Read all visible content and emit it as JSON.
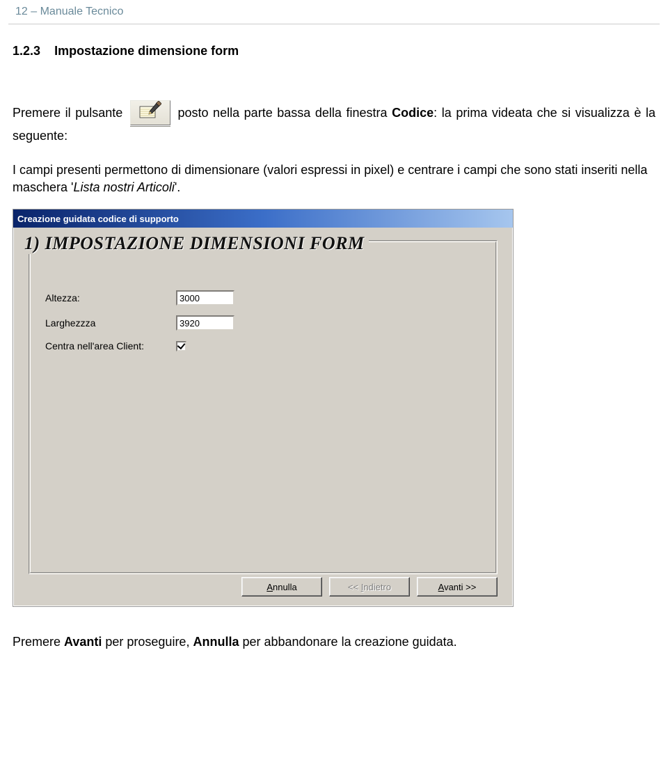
{
  "header": {
    "text": "12 – Manuale Tecnico"
  },
  "section": {
    "number": "1.2.3",
    "title": "Impostazione dimensione form"
  },
  "para1": {
    "before": "Premere il pulsante",
    "after_1": "posto nella parte bassa della finestra ",
    "codice_label": "Codice",
    "after_2": ": la prima videata che si visualizza è la seguente:"
  },
  "para2": {
    "line1": "I campi presenti permettono di dimensionare (valori espressi in pixel) e centrare i campi che sono stati inseriti nella maschera '",
    "italic": "Lista nostri Articoli",
    "after": "'."
  },
  "dialog": {
    "title": "Creazione guidata codice di supporto",
    "heading": "1) IMPOSTAZIONE DIMENSIONI FORM",
    "fields": {
      "altezza": {
        "label": "Altezza:",
        "value": "3000"
      },
      "larghezza": {
        "label": "Larghezzza",
        "value": "3920"
      },
      "centra": {
        "label": "Centra nell'area Client:",
        "checked": true
      }
    },
    "buttons": {
      "annulla": {
        "u": "A",
        "rest": "nnulla"
      },
      "indietro": {
        "prefix": "<<  ",
        "u": "I",
        "rest": "ndietro"
      },
      "avanti": {
        "u": "A",
        "rest": "vanti  >>"
      }
    }
  },
  "footer": {
    "pre": "Premere ",
    "avanti": "Avanti",
    "mid": " per proseguire, ",
    "annulla": "Annulla",
    "post": " per abbandonare la creazione guidata."
  }
}
